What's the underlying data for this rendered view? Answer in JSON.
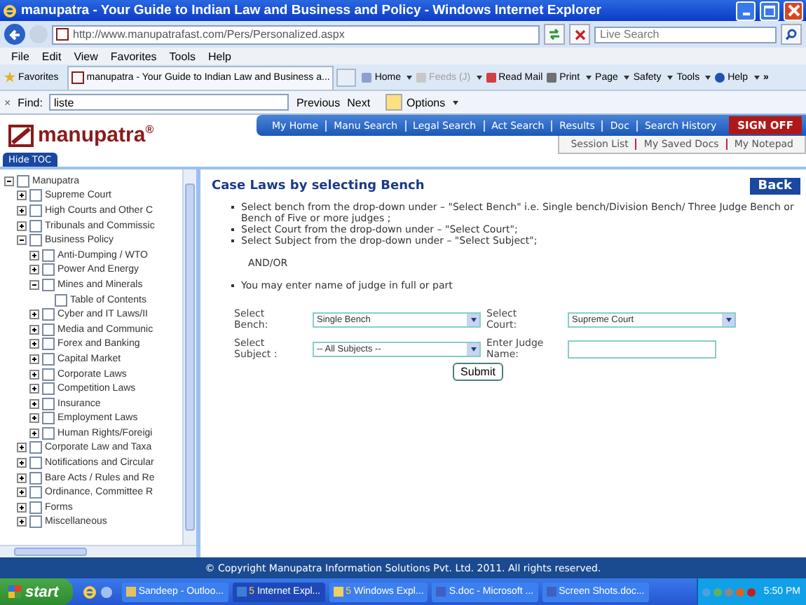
{
  "window": {
    "title": "manupatra - Your Guide to Indian Law and Business and Policy - Windows Internet Explorer"
  },
  "address_bar": {
    "url": "http://www.manupatrafast.com/Pers/Personalized.aspx",
    "search_placeholder": "Live Search"
  },
  "menu_bar": [
    "File",
    "Edit",
    "View",
    "Favorites",
    "Tools",
    "Help"
  ],
  "favorites_button": "Favorites",
  "tab": {
    "title": "manupatra - Your Guide to Indian Law and Business a..."
  },
  "command_bar": [
    {
      "label": "Home",
      "disabled": false,
      "dropdown": true
    },
    {
      "label": "Feeds (J)",
      "disabled": true,
      "dropdown": true
    },
    {
      "label": "Read Mail",
      "disabled": false,
      "dropdown": false
    },
    {
      "label": "Print",
      "disabled": false,
      "dropdown": true
    },
    {
      "label": "Page",
      "disabled": false,
      "dropdown": true
    },
    {
      "label": "Safety",
      "disabled": false,
      "dropdown": true
    },
    {
      "label": "Tools",
      "disabled": false,
      "dropdown": true
    },
    {
      "label": "Help",
      "disabled": false,
      "dropdown": true
    }
  ],
  "command_more": "»",
  "find_bar": {
    "close": "×",
    "label": "Find:",
    "value": "liste",
    "previous": "Previous",
    "next": "Next",
    "options": "Options"
  },
  "site": {
    "logo": "manupatra$^{®}$",
    "nav": [
      "My Home",
      "Manu Search",
      "Legal Search",
      "Act Search",
      "Results",
      "Doc",
      "Search History"
    ],
    "sign_off": "SIGN OFF",
    "subnav": [
      "Session List",
      "My Saved Docs",
      "My Notepad"
    ],
    "hide_toc": "Hide TOC"
  },
  "toc": [
    {
      "label": "Manupatra",
      "kind": "branch",
      "expanded": true,
      "checked": false,
      "children": [
        {
          "label": "Supreme Court",
          "kind": "branch",
          "expanded": false,
          "checked": false
        },
        {
          "label": "High Courts and Other C",
          "kind": "branch",
          "expanded": false,
          "checked": false
        },
        {
          "label": "Tribunals and Commissic",
          "kind": "branch",
          "expanded": false,
          "checked": false
        },
        {
          "label": "Business Policy",
          "kind": "branch",
          "expanded": true,
          "checked": false,
          "children": [
            {
              "label": "Anti-Dumping / WTO",
              "kind": "branch",
              "expanded": false,
              "checked": false
            },
            {
              "label": "Power And Energy",
              "kind": "branch",
              "expanded": false,
              "checked": false
            },
            {
              "label": "Mines and Minerals",
              "kind": "branch",
              "expanded": true,
              "checked": false,
              "children": [
                {
                  "label": "Table of Contents",
                  "kind": "leaf",
                  "checked": false
                }
              ]
            },
            {
              "label": "Cyber and IT Laws/II",
              "kind": "branch",
              "expanded": false,
              "checked": false
            },
            {
              "label": "Media and Communic",
              "kind": "branch",
              "expanded": false,
              "checked": false
            },
            {
              "label": "Forex and Banking",
              "kind": "branch",
              "expanded": false,
              "checked": false
            },
            {
              "label": "Capital Market",
              "kind": "branch",
              "expanded": false,
              "checked": false
            },
            {
              "label": "Corporate Laws",
              "kind": "branch",
              "expanded": false,
              "checked": false
            },
            {
              "label": "Competition Laws",
              "kind": "branch",
              "expanded": false,
              "checked": false
            },
            {
              "label": "Insurance",
              "kind": "branch",
              "expanded": false,
              "checked": false
            },
            {
              "label": "Employment Laws",
              "kind": "branch",
              "expanded": false,
              "checked": false
            },
            {
              "label": "Human Rights/Foreigi",
              "kind": "branch",
              "expanded": false,
              "checked": false
            }
          ]
        },
        {
          "label": "Corporate Law and Taxa",
          "kind": "branch",
          "expanded": false,
          "checked": false
        },
        {
          "label": "Notifications and Circular",
          "kind": "branch",
          "expanded": false,
          "checked": false
        },
        {
          "label": "Bare Acts / Rules and Re",
          "kind": "branch",
          "expanded": false,
          "checked": false
        },
        {
          "label": "Ordinance, Committee R",
          "kind": "branch",
          "expanded": false,
          "checked": false
        },
        {
          "label": "Forms",
          "kind": "branch",
          "expanded": false,
          "checked": false
        },
        {
          "label": "Miscellaneous",
          "kind": "branch",
          "expanded": false,
          "checked": false
        }
      ]
    }
  ],
  "main": {
    "title": "Case Laws by selecting Bench",
    "back": "Back",
    "instructions": [
      {
        "kind": "bullet",
        "text": "Select bench from the drop-down under – \"Select Bench\" i.e. Single bench/Division Bench/ Three Judge Bench or Bench of Five or more judges ;"
      },
      {
        "kind": "bullet",
        "text": "Select Court from the drop-down under – \"Select Court\";"
      },
      {
        "kind": "bullet",
        "text": "Select Subject from the drop-down under – \"Select Subject\";"
      },
      {
        "kind": "note",
        "text": "AND/OR"
      },
      {
        "kind": "bullet",
        "text": "You may enter name of judge in full or part"
      }
    ],
    "form": [
      {
        "label": "Select Bench:",
        "kind": "select",
        "value": "Single Bench"
      },
      {
        "label": "Select Court:",
        "kind": "select",
        "value": "Supreme Court"
      },
      {
        "label": "Select Subject :",
        "kind": "select",
        "value": "-- All Subjects --"
      },
      {
        "label": "Enter Judge Name:",
        "kind": "text"
      }
    ],
    "submit": "Submit"
  },
  "footer": "© Copyright Manupatra Information Solutions Pvt. Ltd. 2011. All rights reserved.",
  "taskbar": {
    "start": "start",
    "items": [
      {
        "label": "Sandeep - Outloo...",
        "selected": false
      },
      {
        "label": "Internet Expl...",
        "count": "5",
        "selected": true
      },
      {
        "label": "Windows Expl...",
        "count": "5",
        "selected": false
      },
      {
        "label": "S.doc - Microsoft ...",
        "selected": false
      },
      {
        "label": "Screen Shots.doc...",
        "selected": false
      }
    ],
    "clock": "5:50 PM"
  }
}
